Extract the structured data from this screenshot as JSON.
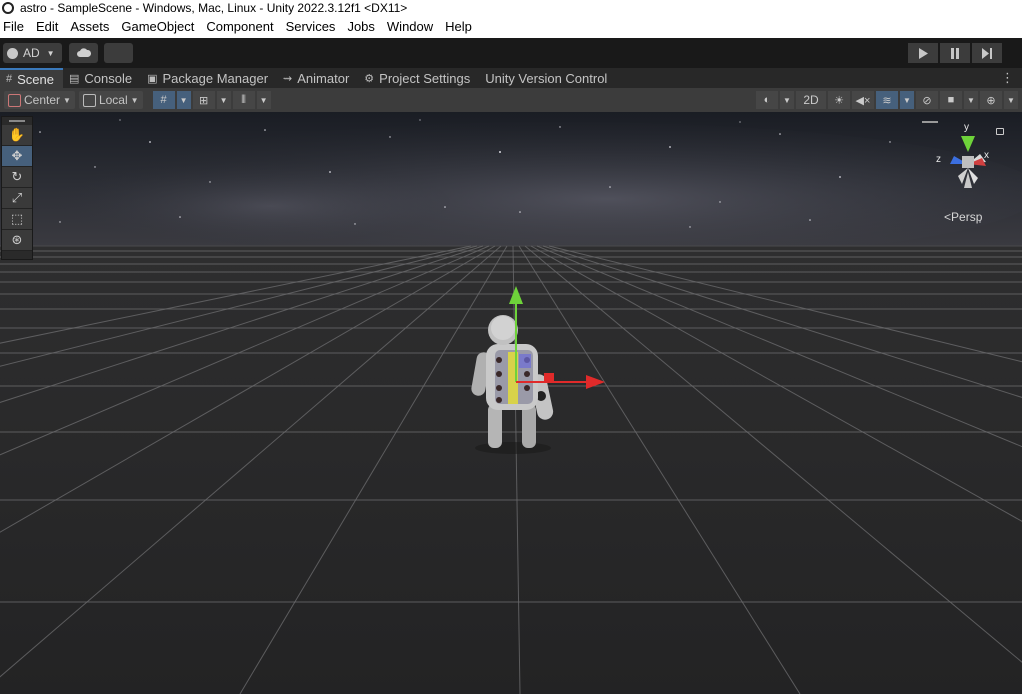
{
  "window": {
    "title": "astro - SampleScene - Windows, Mac, Linux - Unity 2022.3.12f1 <DX11>"
  },
  "menubar": {
    "items": [
      "File",
      "Edit",
      "Assets",
      "GameObject",
      "Component",
      "Services",
      "Jobs",
      "Window",
      "Help"
    ]
  },
  "toolbar": {
    "account_label": "AD",
    "cloud_icon": "cloud-icon",
    "play_icon": "play-icon",
    "pause_icon": "pause-icon",
    "step_icon": "step-icon"
  },
  "tabs": [
    {
      "label": "Scene",
      "icon": "grid-icon",
      "active": true
    },
    {
      "label": "Console",
      "icon": "console-icon",
      "active": false
    },
    {
      "label": "Package Manager",
      "icon": "package-icon",
      "active": false
    },
    {
      "label": "Animator",
      "icon": "animator-icon",
      "active": false
    },
    {
      "label": "Project Settings",
      "icon": "gear-icon",
      "active": false
    },
    {
      "label": "Unity Version Control",
      "icon": "",
      "active": false
    }
  ],
  "scene_toolbar": {
    "pivot_label": "Center",
    "space_label": "Local",
    "mode_2d_label": "2D"
  },
  "tools": [
    "hand-tool",
    "move-tool",
    "rotate-tool",
    "scale-tool",
    "rect-tool",
    "transform-tool"
  ],
  "gizmo": {
    "projection_label": "Persp",
    "y_label": "y",
    "z_label": "z",
    "x_label": "x"
  },
  "colors": {
    "accent": "#3a79bb",
    "active_tool": "#46607c",
    "axis_y": "#6ed33a",
    "axis_x": "#e02a2a",
    "axis_z": "#3b6fe0"
  }
}
